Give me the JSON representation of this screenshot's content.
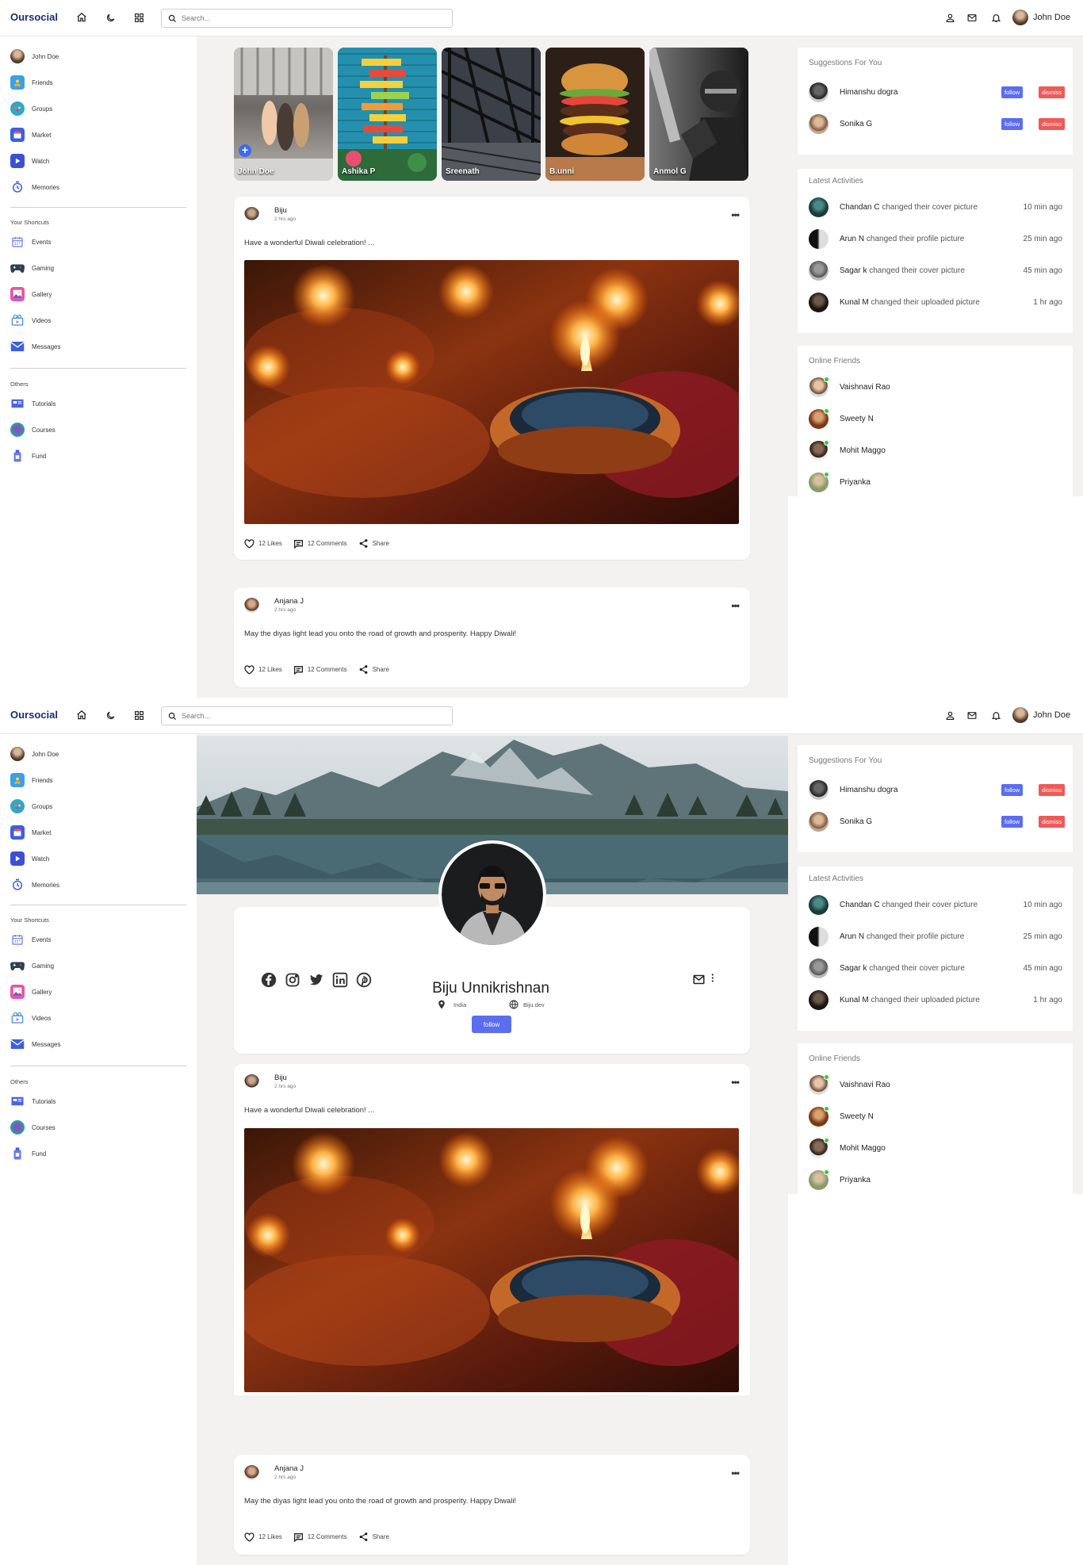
{
  "app": {
    "logo": "Oursocial",
    "search_placeholder": "Search...",
    "user_name": "John Doe"
  },
  "sidebar": {
    "items": [
      {
        "label": "John Doe",
        "icon": "user-avatar-icon"
      },
      {
        "label": "Friends",
        "icon": "friends-icon"
      },
      {
        "label": "Groups",
        "icon": "groups-icon"
      },
      {
        "label": "Market",
        "icon": "market-icon"
      },
      {
        "label": "Watch",
        "icon": "watch-icon"
      },
      {
        "label": "Memories",
        "icon": "memories-icon"
      }
    ],
    "shortcuts_title": "Your Shortcuts",
    "shortcuts": [
      {
        "label": "Events",
        "icon": "events-icon"
      },
      {
        "label": "Gaming",
        "icon": "gaming-icon"
      },
      {
        "label": "Gallery",
        "icon": "gallery-icon"
      },
      {
        "label": "Videos",
        "icon": "videos-icon"
      },
      {
        "label": "Messages",
        "icon": "messages-icon"
      }
    ],
    "others_title": "Others",
    "others": [
      {
        "label": "Tutorials",
        "icon": "tutorials-icon"
      },
      {
        "label": "Courses",
        "icon": "courses-icon"
      },
      {
        "label": "Fund",
        "icon": "fund-icon"
      }
    ]
  },
  "stories": [
    {
      "name": "John Doe"
    },
    {
      "name": "Ashika P"
    },
    {
      "name": "Sreenath"
    },
    {
      "name": "B.unni"
    },
    {
      "name": "Anmol G"
    }
  ],
  "posts": [
    {
      "author": "Biju",
      "time": "2 hrs ago",
      "text": "Have a wonderful Diwali celebration! ...",
      "likes": "12 Likes",
      "comments": "12 Comments",
      "share": "Share"
    },
    {
      "author": "Anjana J",
      "time": "2 hrs ago",
      "text": "May the diyas light lead you onto the road of growth and prosperity. Happy Diwali!",
      "likes": "12 Likes",
      "comments": "12 Comments",
      "share": "Share"
    }
  ],
  "profile": {
    "name": "Biju Unnikrishnan",
    "location": "India",
    "website": "Biju.dev",
    "follow_label": "follow"
  },
  "suggestions": {
    "title": "Suggestions For You",
    "follow_label": "follow",
    "dismiss_label": "dismiss",
    "people": [
      {
        "name": "Himanshu dogra"
      },
      {
        "name": "Sonika G"
      }
    ]
  },
  "activities": {
    "title": "Latest Activities",
    "items": [
      {
        "name": "Chandan C",
        "action": "changed their cover picture",
        "time": "10 min ago"
      },
      {
        "name": "Arun N",
        "action": "changed their profile picture",
        "time": "25 min ago"
      },
      {
        "name": "Sagar k",
        "action": "changed their cover picture",
        "time": "45 min ago"
      },
      {
        "name": "Kunal M",
        "action": "changed their uploaded picture",
        "time": "1 hr ago"
      }
    ]
  },
  "online": {
    "title": "Online Friends",
    "friends": [
      {
        "name": "Vaishnavi Rao"
      },
      {
        "name": "Sweety N"
      },
      {
        "name": "Mohit Maggo"
      },
      {
        "name": "Priyanka"
      }
    ]
  },
  "colors": {
    "brand": "#1e2c70",
    "follow": "#5b6df0",
    "dismiss": "#ee5a57",
    "online": "#2ecc40",
    "background": "#f3f2f1"
  }
}
